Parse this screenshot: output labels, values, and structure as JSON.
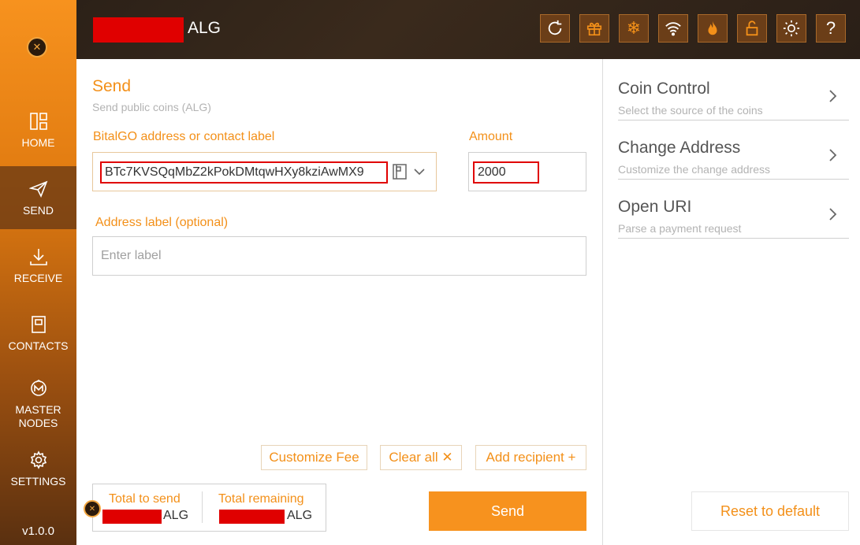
{
  "topbar": {
    "balance_unit": "ALG",
    "buttons": [
      "refresh-icon",
      "gift-icon",
      "snowflake-icon",
      "wifi-icon",
      "flame-icon",
      "unlock-icon",
      "sun-icon",
      "help-icon"
    ]
  },
  "sidebar": {
    "items": [
      {
        "label": "HOME",
        "icon": "home-icon"
      },
      {
        "label": "SEND",
        "icon": "send-icon"
      },
      {
        "label": "RECEIVE",
        "icon": "download-icon"
      },
      {
        "label": "CONTACTS",
        "icon": "contacts-icon"
      },
      {
        "label": "MASTER\nNODES",
        "icon": "masternodes-icon"
      },
      {
        "label": "SETTINGS",
        "icon": "gear-icon"
      }
    ],
    "version": "v1.0.0"
  },
  "send": {
    "title": "Send",
    "subtitle": "Send public coins (ALG)",
    "address_label": "BitalGO address or contact label",
    "address_value": "BTc7KVSQqMbZ2kPokDMtqwHXy8kziAwMX9",
    "amount_label": "Amount",
    "amount_value": "2000",
    "addr_label_label": "Address label (optional)",
    "addr_label_placeholder": "Enter label",
    "customize_fee": "Customize Fee",
    "clear_all": "Clear all ✕",
    "add_recipient": "Add recipient +",
    "total_to_send_label": "Total to send",
    "total_remaining_label": "Total remaining",
    "unit": "ALG",
    "send_button": "Send"
  },
  "right_panel": {
    "items": [
      {
        "title": "Coin Control",
        "subtitle": "Select the source of the coins"
      },
      {
        "title": "Change Address",
        "subtitle": "Customize the change address"
      },
      {
        "title": "Open URI",
        "subtitle": "Parse a payment request"
      }
    ],
    "reset_button": "Reset to default"
  },
  "colors": {
    "accent": "#f39019",
    "sidebar_top": "#f7921e",
    "topbar": "#2c2118",
    "redaction": "#e00000"
  }
}
